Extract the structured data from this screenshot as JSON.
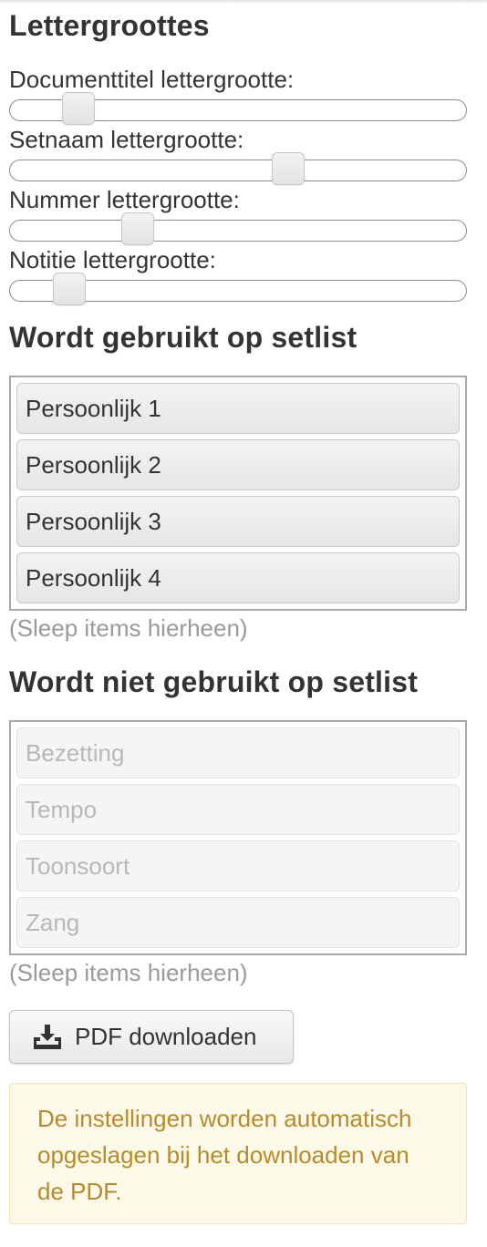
{
  "fonts": {
    "heading": "Lettergroottes",
    "sliders": [
      {
        "label": "Documenttitel lettergrootte:",
        "level": 0.15
      },
      {
        "label": "Setnaam lettergrootte:",
        "level": 0.61
      },
      {
        "label": "Nummer lettergrootte:",
        "level": 0.28
      },
      {
        "label": "Notitie lettergrootte:",
        "level": 0.13
      }
    ]
  },
  "used": {
    "heading": "Wordt gebruikt op setlist",
    "items": [
      "Persoonlijk 1",
      "Persoonlijk 2",
      "Persoonlijk 3",
      "Persoonlijk 4"
    ],
    "hint": "(Sleep items hierheen)"
  },
  "unused": {
    "heading": "Wordt niet gebruikt op setlist",
    "items": [
      "Bezetting",
      "Tempo",
      "Toonsoort",
      "Zang"
    ],
    "hint": "(Sleep items hierheen)"
  },
  "download": {
    "label": "PDF downloaden",
    "icon": "download-tray-icon"
  },
  "notice": "De instellingen worden automatisch opgeslagen bij het downloaden van de PDF.",
  "colors": {
    "notice_text": "#b88b2a",
    "notice_bg": "#fdf9e8"
  }
}
